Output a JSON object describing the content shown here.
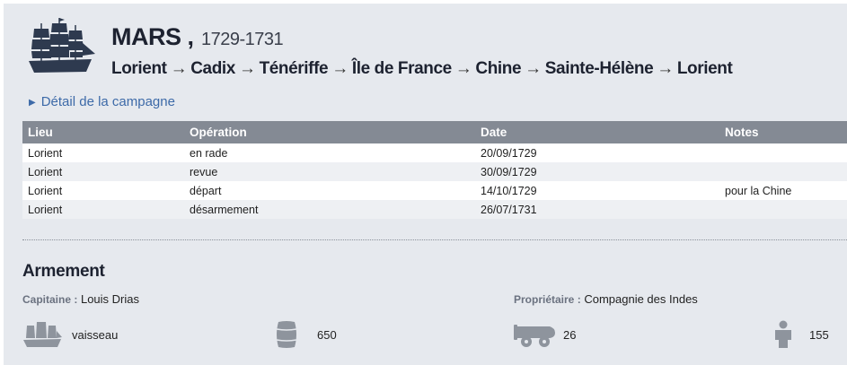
{
  "ship": {
    "name": "MARS ,",
    "years": "1729-1731"
  },
  "route": [
    "Lorient",
    "Cadix",
    "Ténériffe",
    "Île de France",
    "Chine",
    "Sainte-Hélène",
    "Lorient"
  ],
  "route_arrow": "→",
  "detail_link": "Détail de la campagne",
  "table": {
    "headers": [
      "Lieu",
      "Opération",
      "Date",
      "Notes"
    ],
    "rows": [
      [
        "Lorient",
        "en rade",
        "20/09/1729",
        ""
      ],
      [
        "Lorient",
        "revue",
        "30/09/1729",
        ""
      ],
      [
        "Lorient",
        "départ",
        "14/10/1729",
        "pour la Chine"
      ],
      [
        "Lorient",
        "désarmement",
        "26/07/1731",
        ""
      ]
    ]
  },
  "armement": {
    "title": "Armement",
    "captain_label": "Capitaine :",
    "captain": "Louis Drias",
    "owner_label": "Propriétaire :",
    "owner": "Compagnie des Indes",
    "ship_type": "vaisseau",
    "tonnage": "650",
    "cannons": "26",
    "crew": "155"
  },
  "icons": {
    "logo": "ship-icon",
    "type": "ship-icon",
    "tonnage": "barrel-icon",
    "cannons": "cannon-icon",
    "crew": "sailor-icon"
  },
  "colors": {
    "icon": "#8e949d",
    "logo": "#2e3a4f",
    "link": "#3d6aa8",
    "header": "#848a94"
  }
}
